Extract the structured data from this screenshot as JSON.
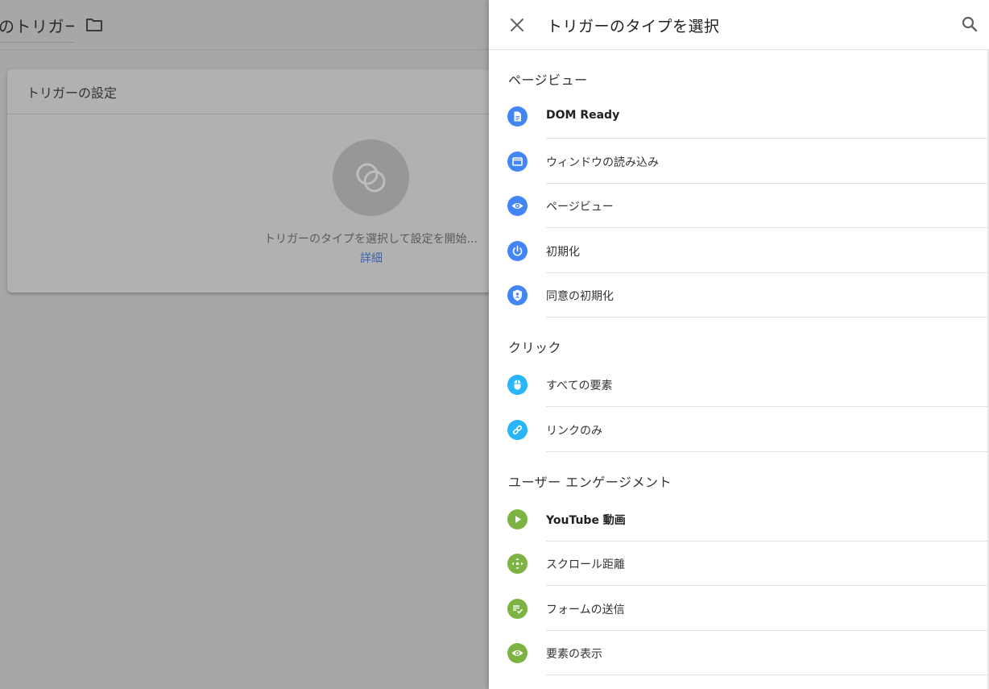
{
  "background": {
    "title": "のトリガー",
    "card": {
      "title": "トリガーの設定",
      "hint": "トリガーのタイプを選択して設定を開始...",
      "link": "詳細"
    }
  },
  "panel": {
    "title": "トリガーのタイプを選択",
    "sections": [
      {
        "title": "ページビュー",
        "items": [
          {
            "label": "DOM Ready",
            "icon": "document-icon",
            "color": "#4285f4"
          },
          {
            "label": "ウィンドウの読み込み",
            "icon": "window-icon",
            "color": "#4285f4"
          },
          {
            "label": "ページビュー",
            "icon": "eye-icon",
            "color": "#4285f4"
          },
          {
            "label": "初期化",
            "icon": "power-icon",
            "color": "#4285f4"
          },
          {
            "label": "同意の初期化",
            "icon": "shield-icon",
            "color": "#4285f4"
          }
        ]
      },
      {
        "title": "クリック",
        "items": [
          {
            "label": "すべての要素",
            "icon": "mouse-icon",
            "color": "#29b6f6"
          },
          {
            "label": "リンクのみ",
            "icon": "link-icon",
            "color": "#29b6f6"
          }
        ]
      },
      {
        "title": "ユーザー エンゲージメント",
        "items": [
          {
            "label": "YouTube 動画",
            "icon": "play-icon",
            "color": "#7cb342"
          },
          {
            "label": "スクロール距離",
            "icon": "scroll-icon",
            "color": "#7cb342"
          },
          {
            "label": "フォームの送信",
            "icon": "form-icon",
            "color": "#7cb342"
          },
          {
            "label": "要素の表示",
            "icon": "eye-icon",
            "color": "#7cb342"
          }
        ]
      }
    ]
  }
}
